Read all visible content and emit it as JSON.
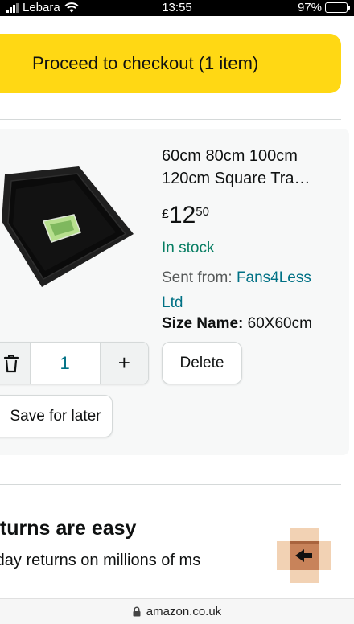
{
  "status_bar": {
    "carrier": "Lebara",
    "time": "13:55",
    "battery": "97%"
  },
  "checkout": {
    "label": "Proceed to checkout (1 item)"
  },
  "cart_item": {
    "title_line1": "60cm 80cm 100cm",
    "title_line2": "120cm Square Tra…",
    "price_symbol": "£",
    "price_main": "12",
    "price_fraction": "50",
    "stock_status": "In stock",
    "sent_from_label": "Sent from:",
    "seller": "Fans4Less Ltd",
    "size_label": "Size Name:",
    "size_value": "60X60cm",
    "quantity": "1",
    "plus_symbol": "+",
    "delete_label": "Delete",
    "save_label": "Save for later"
  },
  "returns": {
    "title": "eturns are easy",
    "text": "-day returns on millions of ms"
  },
  "url_bar": {
    "url": "amazon.co.uk"
  },
  "colors": {
    "checkout_yellow": "#ffd814",
    "in_stock_green": "#067d62",
    "link_teal": "#007185",
    "card_background": "#f7f8f8"
  },
  "icons": [
    "wifi-icon",
    "battery-icon",
    "trash-icon",
    "plus-icon",
    "returns-box-icon",
    "lock-icon"
  ]
}
